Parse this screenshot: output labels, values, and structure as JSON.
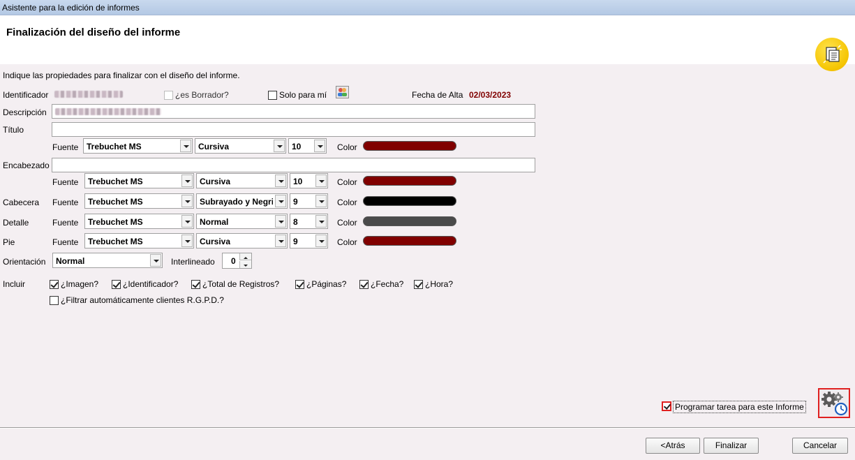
{
  "window": {
    "title": "Asistente para la edición de informes"
  },
  "header": {
    "title": "Finalización del diseño del informe"
  },
  "instructions": "Indique las propiedades para finalizar con el diseño del informe.",
  "form": {
    "identificador_label": "Identificador",
    "borrador_label": "¿es Borrador?",
    "borrador_checked": false,
    "solo_label": "Solo para mí",
    "solo_checked": false,
    "fecha_alta_label": "Fecha de Alta",
    "fecha_alta_value": "02/03/2023",
    "descripcion_label": "Descripción",
    "titulo_label": "Título",
    "titulo_value": "",
    "encabezado_label": "Encabezado",
    "encabezado_value": "",
    "fuente_label": "Fuente",
    "color_label": "Color",
    "cabecera_label": "Cabecera",
    "detalle_label": "Detalle",
    "pie_label": "Pie",
    "orientacion_label": "Orientación",
    "orientacion_value": "Normal",
    "interlineado_label": "Interlineado",
    "interlineado_value": "0",
    "incluir_label": "Incluir"
  },
  "font_rows": {
    "titulo": {
      "font": "Trebuchet MS",
      "style": "Cursiva",
      "size": "10",
      "color": "#800000"
    },
    "encabezado": {
      "font": "Trebuchet MS",
      "style": "Cursiva",
      "size": "10",
      "color": "#800000"
    },
    "cabecera": {
      "font": "Trebuchet MS",
      "style": "Subrayado y Negrita",
      "size": "9",
      "color": "#000000"
    },
    "detalle": {
      "font": "Trebuchet MS",
      "style": "Normal",
      "size": "8",
      "color": "#4a4a4a"
    },
    "pie": {
      "font": "Trebuchet MS",
      "style": "Cursiva",
      "size": "9",
      "color": "#800000"
    }
  },
  "include": {
    "imagen": "¿Imagen?",
    "identificador": "¿Identificador?",
    "total": "¿Total de Registros?",
    "paginas": "¿Páginas?",
    "fecha": "¿Fecha?",
    "hora": "¿Hora?",
    "filtrar": "¿Filtrar automáticamente clientes R.G.P.D.?"
  },
  "schedule": {
    "label": "Programar tarea para este Informe",
    "checked": true
  },
  "buttons": {
    "back": "<Atrás",
    "finish": "Finalizar",
    "cancel": "Cancelar"
  },
  "colors": {
    "accent_red": "#e02020",
    "date_red": "#800000"
  },
  "icons": [
    "report-wizard-icon",
    "people-icon",
    "gear-clock-icon"
  ]
}
